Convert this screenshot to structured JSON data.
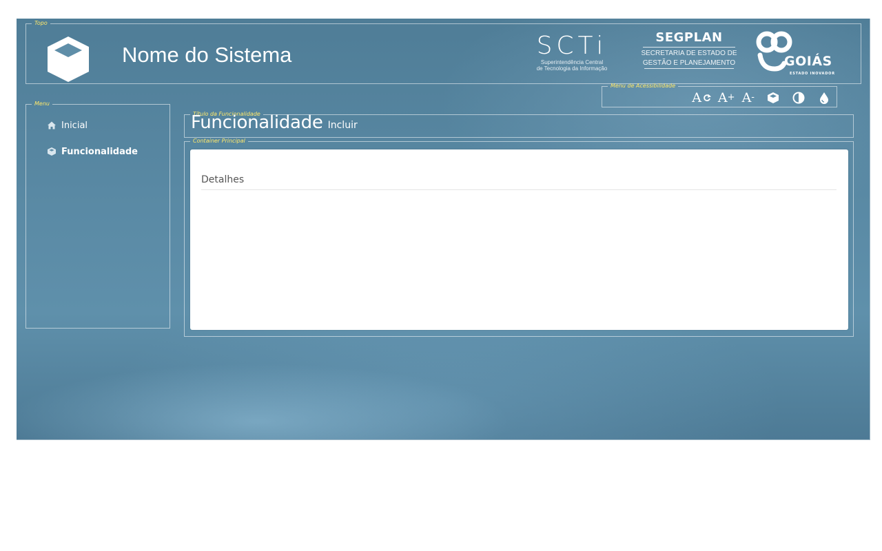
{
  "header": {
    "legend": "Topo",
    "system_name": "Nome do Sistema",
    "scti": {
      "word": "SCTi",
      "line1": "Superintendência Central",
      "line2": "de Tecnologia da Informação"
    },
    "segplan": {
      "word": "SEGPLAN",
      "line1": "SECRETARIA DE ESTADO DE",
      "line2": "GESTÃO E PLANEJAMENTO"
    },
    "goias": {
      "word": "GOIÁS",
      "tagline": "ESTADO INOVADOR"
    }
  },
  "accessibility": {
    "legend": "Menu de Acessibilidade",
    "reset_font": "A",
    "increase_font_letter": "A",
    "increase_font_sign": "+",
    "decrease_font_letter": "A",
    "decrease_font_sign": "-",
    "icons": [
      "font-reset-icon",
      "font-increase-icon",
      "font-decrease-icon",
      "cube-icon",
      "contrast-icon",
      "drop-icon"
    ]
  },
  "menu": {
    "legend": "Menu",
    "items": [
      {
        "label": "Inicial",
        "icon": "home-icon",
        "active": false
      },
      {
        "label": "Funcionalidade",
        "icon": "cube-icon",
        "active": true
      }
    ]
  },
  "title_section": {
    "legend": "Título da Funcionalidade",
    "title": "Funcionalidade",
    "subtitle": "Incluir"
  },
  "main": {
    "legend": "Container Principal",
    "panel_heading": "Detalhes"
  },
  "colors": {
    "background": "#5a8aa5",
    "legend_text": "#ffe96b",
    "text": "#ffffff",
    "panel": "#ffffff"
  }
}
